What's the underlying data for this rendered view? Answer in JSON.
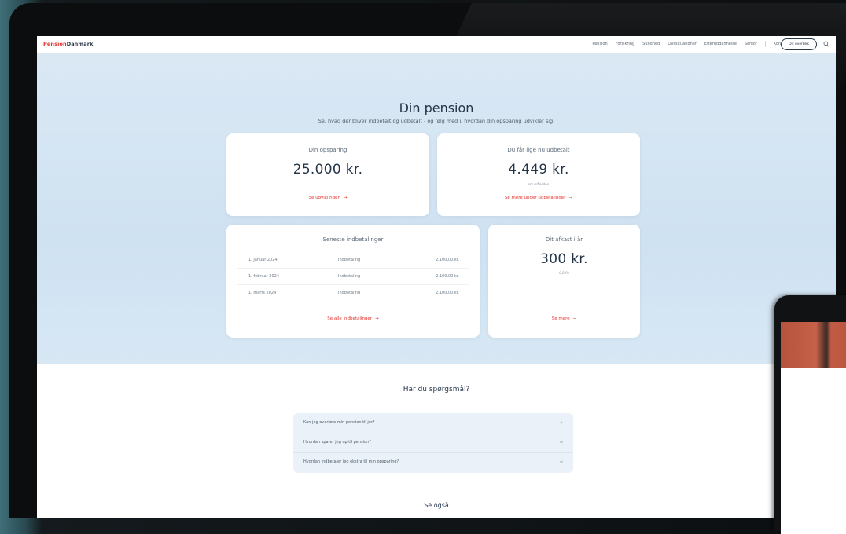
{
  "brand": {
    "part1": "Pension",
    "part2": "Danmark"
  },
  "nav": {
    "links": [
      "Pension",
      "Forsikring",
      "Sundhed",
      "Livssituationer",
      "Efteruddannelse",
      "Senior"
    ],
    "contact": "Kontakt",
    "overview_button": "Dit overblik"
  },
  "hero": {
    "title": "Din pension",
    "subtitle": "Se, hvad der bliver indbetalt og udbetalt - og følg med i, hvordan din opsparing udvikler sig."
  },
  "savings": {
    "label": "Din opsparing",
    "value": "25.000 kr.",
    "link": "Se udviklingen"
  },
  "payout": {
    "label": "Du får lige nu udbetalt",
    "value": "4.449 kr.",
    "note": "om måneden",
    "link": "Se mere under udbetalinger"
  },
  "payments": {
    "label": "Seneste indbetalinger",
    "rows": [
      {
        "date": "1. januar 2024",
        "type": "Indbetaling",
        "amount": "2.100,00 kr."
      },
      {
        "date": "1. februar 2024",
        "type": "Indbetaling",
        "amount": "2.100,00 kr."
      },
      {
        "date": "1. marts 2024",
        "type": "Indbetaling",
        "amount": "2.100,00 kr."
      }
    ],
    "link": "Se alle indbetalinger"
  },
  "returns": {
    "label": "Dit afkast i år",
    "value": "300 kr.",
    "note": "0,05%",
    "link": "Se mere"
  },
  "faq": {
    "title": "Har du spørgsmål?",
    "items": [
      "Kan jeg overføre min pension til jer?",
      "Hvordan sparer jeg op til pension?",
      "Hvordan indbetaler jeg ekstra til min opsparing?"
    ]
  },
  "see_also": "Se også",
  "colors": {
    "accent": "#e4322b",
    "navy": "#24354a",
    "hero_bg": "#d3e5f3"
  },
  "icons": {
    "search": "search-icon",
    "chevron": "chevron-down-icon",
    "arrow": "arrow-right-icon"
  }
}
